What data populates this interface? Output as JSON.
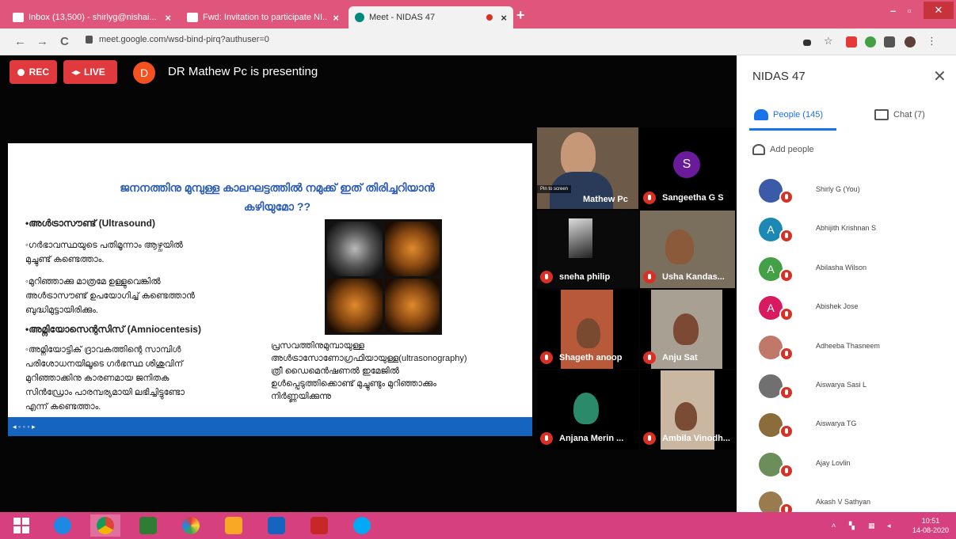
{
  "browser": {
    "tabs": [
      {
        "title": "Inbox (13,500) - shirlyg@nishai...",
        "active": false
      },
      {
        "title": "Fwd: Invitation to participate NI...",
        "active": false
      },
      {
        "title": "Meet - NIDAS 47",
        "active": true
      }
    ],
    "new_tab": "+",
    "url": "meet.google.com/wsd-bind-pirq?authuser=0",
    "nav": {
      "back": "←",
      "forward": "→",
      "reload": "C"
    }
  },
  "meet": {
    "rec_label": "REC",
    "live_label": "LIVE",
    "presenter_initial": "D",
    "presenting_text": "DR Mathew Pc is presenting",
    "slide": {
      "title_line1": "ജനനത്തിനു മുമ്പുള്ള കാലഘട്ടത്തിൽ നമുക്ക് ഇത് തിരിച്ചറിയാൻ",
      "title_line2": "കഴിയുമോ ??",
      "b1_head": "•അൾട്രാസൗണ്ട് (Ultrasound)",
      "b1_l1": "◦ഗർഭാവസ്ഥയുടെ പതിമൂന്നാം ആഴ്ചയിൽ",
      "b1_l2": "മുച്ചുണ്ട് കണ്ടെത്താം.",
      "b1_l3": "◦മുറിഞ്ഞാക്കു മാത്രമേ ഉള്ളുവെങ്കിൽ",
      "b1_l4": "അൾട്രാസൗണ്ട് ഉപയോഗിച്ച് കണ്ടെത്താൻ",
      "b1_l5": "ബുദ്ധിമുട്ടായിരിക്കും.",
      "b2_head": "•അമ്നിയോസെന്റസിസ് (Amniocentesis)",
      "b2_l1": "◦അമ്നിയോട്ടിക് ദ്രാവകത്തിന്റെ സാമ്പിൾ",
      "b2_l2": "പരിശോധനയിലൂടെ ഗർഭസ്ഥ ശിശുവിന്",
      "b2_l3": "മുറിഞ്ഞാക്കിനു കാരണമായ ജനിതക",
      "b2_l4": "സിൻഡ്രോം പാരമ്പര്യമായി ലഭിച്ചിട്ടുണ്ടോ",
      "b2_l5": "എന്ന് കണ്ടെത്താം.",
      "caption_l1": "പ്രസവത്തിനുമുമ്പായുള്ള",
      "caption_l2": "അൾട്രാസോണോഗ്രഫിയായുള്ള(ultrasonography)",
      "caption_l3": "ത്രീ ഡൈമെൻഷണൽ ഇമേജിൽ",
      "caption_l4": "ഉൾപ്പെടുത്തിക്കൊണ്ട് മുച്ചുണ്ടും മുറിഞ്ഞാക്കും",
      "caption_l5": "നിർണ്ണയിക്കുന്നു"
    },
    "tiles": [
      {
        "name": "Mathew Pc",
        "pin": "Pin to screen"
      },
      {
        "name": "Sangeetha G S",
        "initial": "S"
      },
      {
        "name": "sneha philip"
      },
      {
        "name": "Usha Kandas..."
      },
      {
        "name": "Shageth anoop"
      },
      {
        "name": "Anju Sat"
      },
      {
        "name": "Anjana Merin ..."
      },
      {
        "name": "Ambila Vinodh..."
      }
    ]
  },
  "panel": {
    "title": "NIDAS 47",
    "close": "✕",
    "people_tab": "People (145)",
    "chat_tab": "Chat (7)",
    "add_people": "Add people",
    "people": [
      {
        "name": "Shirly G (You)",
        "initial": "",
        "color": "#3b5aa8"
      },
      {
        "name": "Abhijith Krishnan S",
        "initial": "A",
        "color": "#1e88b5"
      },
      {
        "name": "Abilasha Wilson",
        "initial": "A",
        "color": "#43a047"
      },
      {
        "name": "Abishek Jose",
        "initial": "A",
        "color": "#d81b60"
      },
      {
        "name": "Adheeba Thasneem",
        "initial": "",
        "color": "#c0786a"
      },
      {
        "name": "Aiswarya Sasi L",
        "initial": "",
        "color": "#707070"
      },
      {
        "name": "Aiswarya TG",
        "initial": "",
        "color": "#8a6d3b"
      },
      {
        "name": "Ajay Lovlin",
        "initial": "",
        "color": "#6b8e5a"
      },
      {
        "name": "Akash V Sathyan",
        "initial": "",
        "color": "#9a7b4f"
      }
    ]
  },
  "taskbar": {
    "time": "10:51",
    "date": "14-08-2020"
  },
  "colors": {
    "tabbar": "#e0567a",
    "taskbar": "#d6407e",
    "rec_red": "#e0393e",
    "accent_blue": "#1a73e8"
  }
}
